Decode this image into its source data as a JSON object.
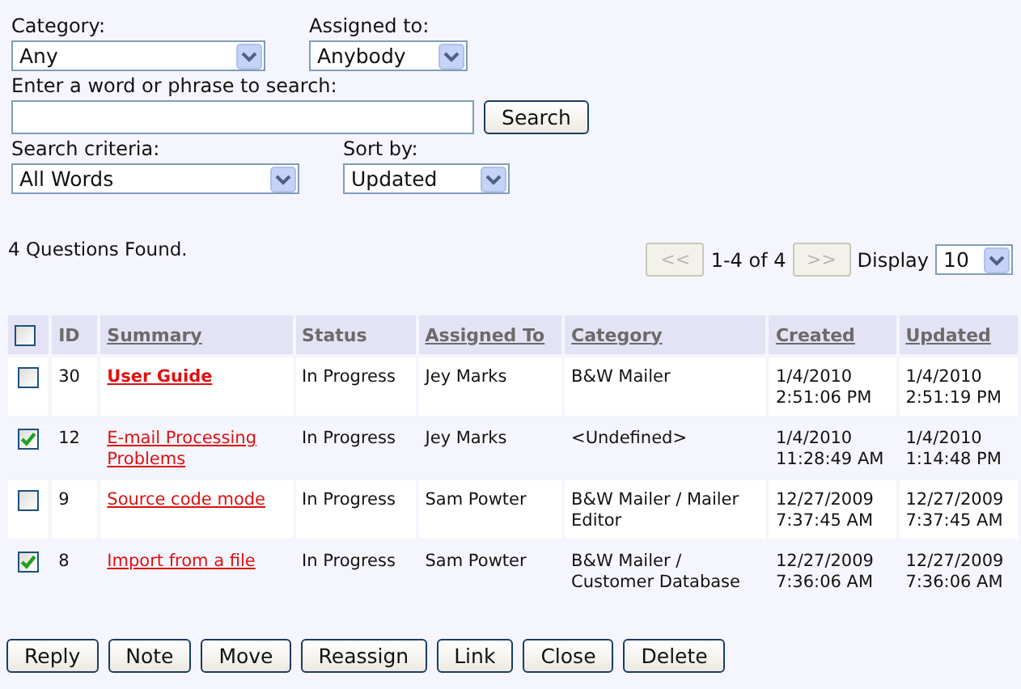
{
  "filters": {
    "category": {
      "label": "Category:",
      "value": "Any"
    },
    "assigned_to": {
      "label": "Assigned to:",
      "value": "Anybody"
    },
    "search": {
      "label": "Enter a word or phrase to search:",
      "button": "Search"
    },
    "search_criteria": {
      "label": "Search criteria:",
      "value": "All Words"
    },
    "sort_by": {
      "label": "Sort by:",
      "value": "Updated"
    }
  },
  "result_count": "4 Questions Found.",
  "pager": {
    "prev": "<<",
    "range": "1-4 of 4",
    "next": ">>",
    "prev_disabled": true,
    "next_disabled": true,
    "display_label": "Display",
    "display_value": "10"
  },
  "table": {
    "select_all_checked": false,
    "columns": [
      {
        "label": "ID",
        "sortable": false
      },
      {
        "label": "Summary",
        "sortable": true
      },
      {
        "label": "Status",
        "sortable": false
      },
      {
        "label": "Assigned To",
        "sortable": true
      },
      {
        "label": "Category",
        "sortable": true
      },
      {
        "label": "Created",
        "sortable": true
      },
      {
        "label": "Updated",
        "sortable": true
      }
    ],
    "rows": [
      {
        "checked": false,
        "id": "30",
        "summary": "User Guide",
        "unread": true,
        "status": "In Progress",
        "assigned_to": "Jey Marks",
        "category": "B&W Mailer",
        "created": "1/4/2010 2:51:06 PM",
        "updated": "1/4/2010 2:51:19 PM"
      },
      {
        "checked": true,
        "id": "12",
        "summary": "E-mail Processing Problems",
        "unread": false,
        "status": "In Progress",
        "assigned_to": "Jey Marks",
        "category": "<Undefined>",
        "created": "1/4/2010 11:28:49 AM",
        "updated": "1/4/2010 1:14:48 PM"
      },
      {
        "checked": false,
        "id": "9",
        "summary": "Source code mode",
        "unread": false,
        "status": "In Progress",
        "assigned_to": "Sam Powter",
        "category": "B&W Mailer / Mailer Editor",
        "created": "12/27/2009 7:37:45 AM",
        "updated": "12/27/2009 7:37:45 AM"
      },
      {
        "checked": true,
        "id": "8",
        "summary": "Import from a file",
        "unread": false,
        "status": "In Progress",
        "assigned_to": "Sam Powter",
        "category": "B&W Mailer / Customer Database",
        "created": "12/27/2009 7:36:06 AM",
        "updated": "12/27/2009 7:36:06 AM"
      }
    ]
  },
  "actions": [
    "Reply",
    "Note",
    "Move",
    "Reassign",
    "Link",
    "Close",
    "Delete"
  ]
}
